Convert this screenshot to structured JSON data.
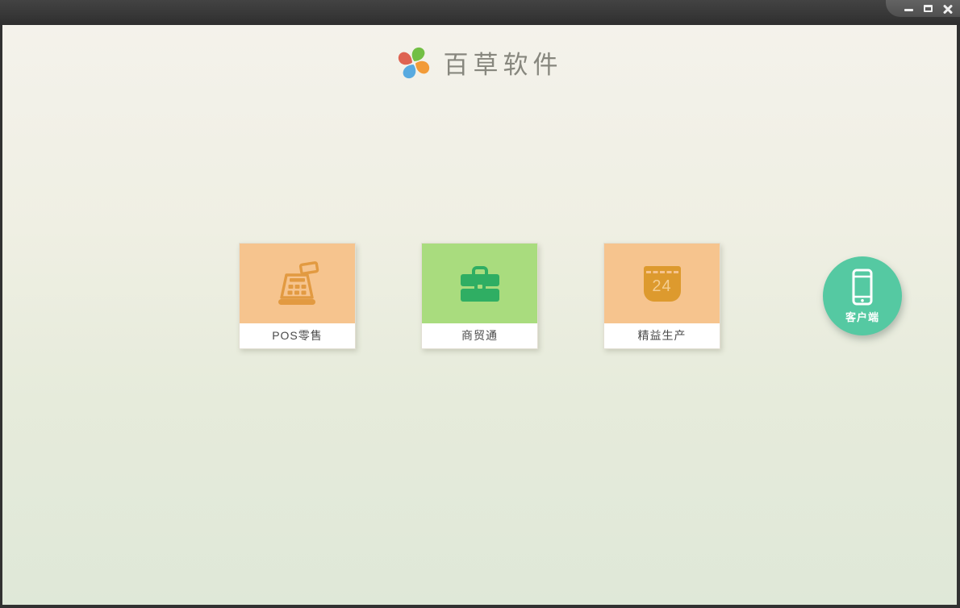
{
  "window": {
    "controls": [
      {
        "id": "minimize",
        "icon": "minimize-icon"
      },
      {
        "id": "restore",
        "icon": "restore-icon"
      },
      {
        "id": "close",
        "icon": "close-icon"
      }
    ],
    "titlebar_color": "#383838"
  },
  "header": {
    "app_name": "百草软件",
    "logo_icon": "pinwheel-logo",
    "logo_colors": {
      "green": "#72bf44",
      "orange": "#f29b38",
      "blue": "#58aae0",
      "red": "#de6352"
    },
    "title_color": "#87877e"
  },
  "products": [
    {
      "label": "POS零售",
      "icon": "cash-register-icon",
      "bg_color": "#f6c48e",
      "icon_color": "#e29a41"
    },
    {
      "label": "商贸通",
      "icon": "briefcase-icon",
      "bg_color": "#a9dc7e",
      "icon_color": "#2fae63"
    },
    {
      "label": "精益生产",
      "icon": "calendar-icon",
      "bg_color": "#f6c48e",
      "icon_color": "#dd9a2e",
      "calendar_number": "24"
    }
  ],
  "client_button": {
    "label": "客户端",
    "icon": "smartphone-icon",
    "bg_color": "#55c9a2"
  },
  "theme": {
    "content_bg_top": "#f4f2eb",
    "content_bg_bottom": "#dfe8d8",
    "card_label_color": "#4a4a4a"
  }
}
